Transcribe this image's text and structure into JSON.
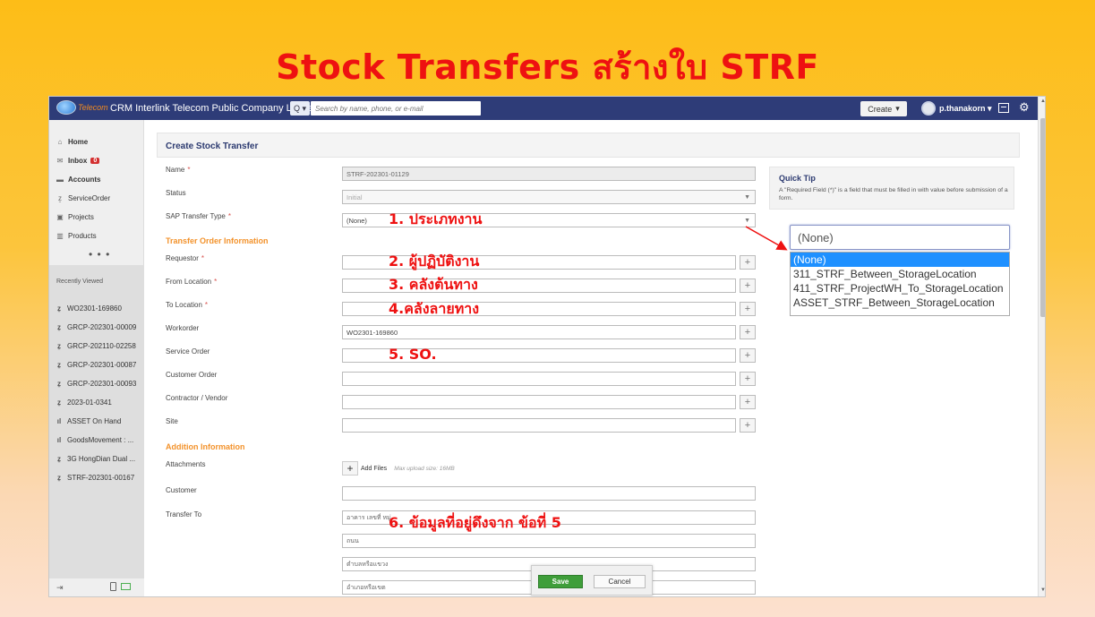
{
  "slide": {
    "title": "Stock Transfers สร้างใบ STRF"
  },
  "topbar": {
    "logo_text": "Telecom",
    "company": "CRM Interlink Telecom Public Company Limited",
    "search_icon": "Q ▾",
    "search_placeholder": "Search by name, phone, or e-mail",
    "create_label": "Create",
    "username": "p.thanakorn ▾"
  },
  "sidebar": {
    "items": [
      {
        "icon": "home-icon",
        "label": "Home"
      },
      {
        "icon": "inbox-icon",
        "label": "Inbox",
        "badge": "0"
      },
      {
        "icon": "folder-icon",
        "label": "Accounts"
      },
      {
        "icon": "service-order-icon",
        "label": "ServiceOrder"
      },
      {
        "icon": "briefcase-icon",
        "label": "Projects"
      },
      {
        "icon": "products-icon",
        "label": "Products"
      }
    ],
    "more": "• • •",
    "recent_title": "Recently Viewed",
    "recent": [
      {
        "icon": "z",
        "label": "WO2301-169860"
      },
      {
        "icon": "z",
        "label": "GRCP-202301-00009"
      },
      {
        "icon": "z",
        "label": "GRCP-202110-02258"
      },
      {
        "icon": "z",
        "label": "GRCP-202301-00087"
      },
      {
        "icon": "z",
        "label": "GRCP-202301-00093"
      },
      {
        "icon": "z",
        "label": "2023-01-0341"
      },
      {
        "icon": "chart",
        "label": "ASSET On Hand"
      },
      {
        "icon": "chart",
        "label": "GoodsMovement : ..."
      },
      {
        "icon": "z",
        "label": "3G HongDian Dual ..."
      },
      {
        "icon": "z",
        "label": "STRF-202301-00167"
      }
    ]
  },
  "form": {
    "title": "Create Stock Transfer",
    "labels": {
      "name": "Name",
      "status": "Status",
      "sap_type": "SAP Transfer Type",
      "section_transfer": "Transfer Order Information",
      "requestor": "Requestor",
      "from_location": "From Location",
      "to_location": "To Location",
      "workorder": "Workorder",
      "service_order": "Service Order",
      "customer_order": "Customer Order",
      "contractor": "Contractor / Vendor",
      "site": "Site",
      "section_addition": "Addition Information",
      "attachments": "Attachments",
      "customer": "Customer",
      "transfer_to": "Transfer To"
    },
    "required_mark": "*",
    "values": {
      "name": "STRF-202301-01129",
      "status": "Initial",
      "sap_type": "(None)",
      "workorder": "WO2301-169860"
    },
    "add_files": "Add Files",
    "upload_note": "Max upload size: 16MB",
    "address_placeholders": [
      "อาคาร เลขที่ หมู่",
      "ถนน",
      "ตำบลหรือแขวง",
      "อำเภอหรือเขต"
    ]
  },
  "quick_tip": {
    "title": "Quick Tip",
    "body": "A \"Required Field (*)\" is a field that must be filled in with value before submission of a form."
  },
  "annotations": {
    "a1": "1. ประเภทงาน",
    "a2": "2. ผู้ปฏิบัติงาน",
    "a3": "3. คลังต้นทาง",
    "a4": "4.คลังลายทาง",
    "a5": "5. SO.",
    "a6": "6. ข้อมูลที่อยู่ดึงจาก ข้อที่ 5"
  },
  "dropdown": {
    "current": "(None)",
    "options": [
      "(None)",
      "311_STRF_Between_StorageLocation",
      "411_STRF_ProjectWH_To_StorageLocation",
      "ASSET_STRF_Between_StorageLocation"
    ],
    "selected_index": 0
  },
  "actions": {
    "save": "Save",
    "cancel": "Cancel"
  },
  "colors": {
    "accent_red": "#ee1111",
    "header_navy": "#2e3c78",
    "section_orange": "#f3922b",
    "save_green": "#3f9e3a"
  }
}
